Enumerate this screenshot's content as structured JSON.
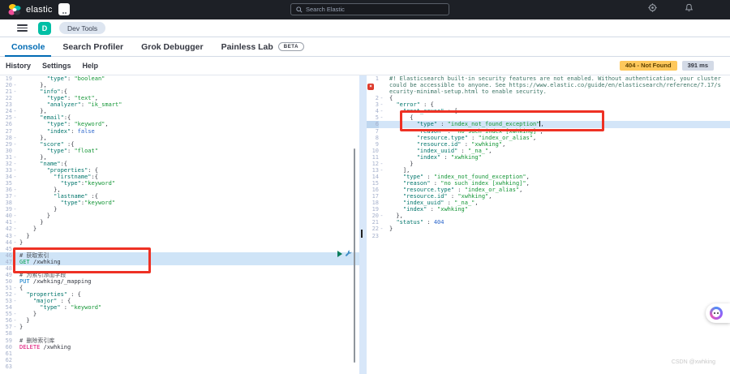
{
  "colors": {
    "header_bg": "#1d2026",
    "accent_blue": "#006bb4",
    "space_avatar_green": "#00bfa5",
    "status_badge_bg": "#fec85c",
    "duration_badge_bg": "#d3dae6",
    "selection_blue": "#cfe4f7",
    "annotation_red": "#ee3124",
    "key_teal": "#00756b",
    "string_green": "#149636",
    "method_get": "#0aa255",
    "method_put": "#0377c9",
    "method_delete": "#dd0a73"
  },
  "header": {
    "logo_text": "elastic",
    "search_placeholder": "Search Elastic"
  },
  "nav": {
    "space_initial": "D",
    "breadcrumb": "Dev Tools"
  },
  "tabs": [
    {
      "label": "Console"
    },
    {
      "label": "Search Profiler"
    },
    {
      "label": "Grok Debugger"
    },
    {
      "label": "Painless Lab",
      "badge": "BETA"
    }
  ],
  "toolbar": {
    "history": "History",
    "settings": "Settings",
    "help": "Help",
    "status_badge": "404 - Not Found",
    "duration_badge": "391 ms"
  },
  "watermark": "CSDN @xwhking",
  "request_editor": {
    "lines": [
      {
        "n": 19,
        "t": [
          [
            "        ",
            "p"
          ],
          [
            "\"type\"",
            "k"
          ],
          [
            ": ",
            "p"
          ],
          [
            "\"boolean\"",
            "s"
          ]
        ]
      },
      {
        "n": 20,
        "fold": true,
        "t": [
          [
            "      },",
            "p"
          ]
        ]
      },
      {
        "n": 21,
        "fold": true,
        "t": [
          [
            "      ",
            "p"
          ],
          [
            "\"info\"",
            "k"
          ],
          [
            ":{",
            "p"
          ]
        ]
      },
      {
        "n": 22,
        "t": [
          [
            "        ",
            "p"
          ],
          [
            "\"type\"",
            "k"
          ],
          [
            ": ",
            "p"
          ],
          [
            "\"text\"",
            "s"
          ],
          [
            ",",
            "p"
          ]
        ]
      },
      {
        "n": 23,
        "t": [
          [
            "        ",
            "p"
          ],
          [
            "\"analyzer\"",
            "k"
          ],
          [
            ": ",
            "p"
          ],
          [
            "\"ik_smart\"",
            "s"
          ]
        ]
      },
      {
        "n": 24,
        "fold": true,
        "t": [
          [
            "      },",
            "p"
          ]
        ]
      },
      {
        "n": 25,
        "fold": true,
        "t": [
          [
            "      ",
            "p"
          ],
          [
            "\"email\"",
            "k"
          ],
          [
            ":{",
            "p"
          ]
        ]
      },
      {
        "n": 26,
        "t": [
          [
            "        ",
            "p"
          ],
          [
            "\"type\"",
            "k"
          ],
          [
            ": ",
            "p"
          ],
          [
            "\"keyword\"",
            "s"
          ],
          [
            ",",
            "p"
          ]
        ]
      },
      {
        "n": 27,
        "t": [
          [
            "        ",
            "p"
          ],
          [
            "\"index\"",
            "k"
          ],
          [
            ": ",
            "p"
          ],
          [
            "false",
            "n"
          ]
        ]
      },
      {
        "n": 28,
        "fold": true,
        "t": [
          [
            "      },",
            "p"
          ]
        ]
      },
      {
        "n": 29,
        "fold": true,
        "t": [
          [
            "      ",
            "p"
          ],
          [
            "\"score\"",
            "k"
          ],
          [
            " :{",
            "p"
          ]
        ]
      },
      {
        "n": 30,
        "t": [
          [
            "        ",
            "p"
          ],
          [
            "\"type\"",
            "k"
          ],
          [
            ": ",
            "p"
          ],
          [
            "\"float\"",
            "s"
          ]
        ]
      },
      {
        "n": 31,
        "fold": true,
        "t": [
          [
            "      },",
            "p"
          ]
        ]
      },
      {
        "n": 32,
        "fold": true,
        "t": [
          [
            "      ",
            "p"
          ],
          [
            "\"name\"",
            "k"
          ],
          [
            ":{",
            "p"
          ]
        ]
      },
      {
        "n": 33,
        "fold": true,
        "t": [
          [
            "        ",
            "p"
          ],
          [
            "\"properties\"",
            "k"
          ],
          [
            ": {",
            "p"
          ]
        ]
      },
      {
        "n": 34,
        "fold": true,
        "t": [
          [
            "          ",
            "p"
          ],
          [
            "\"firstname\"",
            "k"
          ],
          [
            ":{",
            "p"
          ]
        ]
      },
      {
        "n": 35,
        "t": [
          [
            "            ",
            "p"
          ],
          [
            "\"type\"",
            "k"
          ],
          [
            ":",
            "p"
          ],
          [
            "\"keyword\"",
            "s"
          ]
        ]
      },
      {
        "n": 36,
        "fold": true,
        "t": [
          [
            "          },",
            "p"
          ]
        ]
      },
      {
        "n": 37,
        "fold": true,
        "t": [
          [
            "          ",
            "p"
          ],
          [
            "\"lastname\"",
            "k"
          ],
          [
            " :{",
            "p"
          ]
        ]
      },
      {
        "n": 38,
        "t": [
          [
            "            ",
            "p"
          ],
          [
            "\"type\"",
            "k"
          ],
          [
            ":",
            "p"
          ],
          [
            "\"keyword\"",
            "s"
          ]
        ]
      },
      {
        "n": 39,
        "fold": true,
        "t": [
          [
            "          }",
            "p"
          ]
        ]
      },
      {
        "n": 40,
        "fold": true,
        "t": [
          [
            "        }",
            "p"
          ]
        ]
      },
      {
        "n": 41,
        "fold": true,
        "t": [
          [
            "      }",
            "p"
          ]
        ]
      },
      {
        "n": 42,
        "fold": true,
        "t": [
          [
            "    }",
            "p"
          ]
        ]
      },
      {
        "n": 43,
        "fold": true,
        "t": [
          [
            "  }",
            "p"
          ]
        ]
      },
      {
        "n": 44,
        "fold": true,
        "t": [
          [
            "}",
            "p"
          ]
        ]
      },
      {
        "n": 45,
        "t": []
      },
      {
        "n": 46,
        "hl": true,
        "t": [
          [
            "# 获取索引",
            "c"
          ]
        ]
      },
      {
        "n": 47,
        "hl": true,
        "t": [
          [
            "GET",
            "get"
          ],
          [
            " /xwhking",
            "u"
          ]
        ]
      },
      {
        "n": 48,
        "t": []
      },
      {
        "n": 49,
        "t": [
          [
            "# 为索引添加字段",
            "c"
          ]
        ]
      },
      {
        "n": 50,
        "t": [
          [
            "PUT",
            "put"
          ],
          [
            " /xwhking/_mapping",
            "u"
          ]
        ]
      },
      {
        "n": 51,
        "fold": true,
        "t": [
          [
            "{",
            "p"
          ]
        ]
      },
      {
        "n": 52,
        "fold": true,
        "t": [
          [
            "  ",
            "p"
          ],
          [
            "\"properties\"",
            "k"
          ],
          [
            " : {",
            "p"
          ]
        ]
      },
      {
        "n": 53,
        "fold": true,
        "t": [
          [
            "    ",
            "p"
          ],
          [
            "\"major\"",
            "k"
          ],
          [
            " : {",
            "p"
          ]
        ]
      },
      {
        "n": 54,
        "t": [
          [
            "      ",
            "p"
          ],
          [
            "\"type\"",
            "k"
          ],
          [
            " : ",
            "p"
          ],
          [
            "\"keyword\"",
            "s"
          ]
        ]
      },
      {
        "n": 55,
        "fold": true,
        "t": [
          [
            "    }",
            "p"
          ]
        ]
      },
      {
        "n": 56,
        "fold": true,
        "t": [
          [
            "  }",
            "p"
          ]
        ]
      },
      {
        "n": 57,
        "fold": true,
        "t": [
          [
            "}",
            "p"
          ]
        ]
      },
      {
        "n": 58,
        "t": []
      },
      {
        "n": 59,
        "t": [
          [
            "# 删除索引库",
            "c"
          ]
        ]
      },
      {
        "n": 60,
        "t": [
          [
            "DELETE",
            "del"
          ],
          [
            " /xwhking",
            "u"
          ]
        ]
      },
      {
        "n": 61,
        "t": []
      },
      {
        "n": 62,
        "t": []
      },
      {
        "n": 63,
        "t": []
      }
    ]
  },
  "response_editor": {
    "lines": [
      {
        "n": 1,
        "wrap": true,
        "t": [
          [
            "#! Elasticsearch built-in security features are not enabled. Without authentication, your cluster could be accessible to anyone. See https://www.elastic.co/guide/en/elasticsearch/reference/7.17/security-minimal-setup.html to enable security.",
            "w"
          ]
        ]
      },
      {
        "n": 2,
        "fold": true,
        "t": [
          [
            "{",
            "p"
          ]
        ]
      },
      {
        "n": 3,
        "fold": true,
        "t": [
          [
            "  ",
            "p"
          ],
          [
            "\"error\"",
            "k"
          ],
          [
            " : {",
            "p"
          ]
        ]
      },
      {
        "n": 4,
        "fold": true,
        "t": [
          [
            "    ",
            "p"
          ],
          [
            "\"root_cause\"",
            "k"
          ],
          [
            " : [",
            "p"
          ]
        ]
      },
      {
        "n": 5,
        "fold": true,
        "t": [
          [
            "      {",
            "p"
          ]
        ]
      },
      {
        "n": 6,
        "sel": true,
        "t": [
          [
            "        ",
            "p"
          ],
          [
            "\"type\"",
            "k"
          ],
          [
            " : ",
            "p"
          ],
          [
            "\"index_not_found_exception\"",
            "s"
          ],
          [
            "",
            "cur"
          ],
          [
            ",",
            "p"
          ]
        ]
      },
      {
        "n": 7,
        "t": [
          [
            "        ",
            "p"
          ],
          [
            "\"reason\"",
            "k"
          ],
          [
            " : ",
            "p"
          ],
          [
            "\"no such index [xwhking]\"",
            "s"
          ],
          [
            ",",
            "p"
          ]
        ]
      },
      {
        "n": 8,
        "t": [
          [
            "        ",
            "p"
          ],
          [
            "\"resource.type\"",
            "k"
          ],
          [
            " : ",
            "p"
          ],
          [
            "\"index_or_alias\"",
            "s"
          ],
          [
            ",",
            "p"
          ]
        ]
      },
      {
        "n": 9,
        "t": [
          [
            "        ",
            "p"
          ],
          [
            "\"resource.id\"",
            "k"
          ],
          [
            " : ",
            "p"
          ],
          [
            "\"xwhking\"",
            "s"
          ],
          [
            ",",
            "p"
          ]
        ]
      },
      {
        "n": 10,
        "t": [
          [
            "        ",
            "p"
          ],
          [
            "\"index_uuid\"",
            "k"
          ],
          [
            " : ",
            "p"
          ],
          [
            "\"_na_\"",
            "s"
          ],
          [
            ",",
            "p"
          ]
        ]
      },
      {
        "n": 11,
        "t": [
          [
            "        ",
            "p"
          ],
          [
            "\"index\"",
            "k"
          ],
          [
            " : ",
            "p"
          ],
          [
            "\"xwhking\"",
            "s"
          ]
        ]
      },
      {
        "n": 12,
        "fold": true,
        "t": [
          [
            "      }",
            "p"
          ]
        ]
      },
      {
        "n": 13,
        "fold": true,
        "t": [
          [
            "    ],",
            "p"
          ]
        ]
      },
      {
        "n": 14,
        "t": [
          [
            "    ",
            "p"
          ],
          [
            "\"type\"",
            "k"
          ],
          [
            " : ",
            "p"
          ],
          [
            "\"index_not_found_exception\"",
            "s"
          ],
          [
            ",",
            "p"
          ]
        ]
      },
      {
        "n": 15,
        "t": [
          [
            "    ",
            "p"
          ],
          [
            "\"reason\"",
            "k"
          ],
          [
            " : ",
            "p"
          ],
          [
            "\"no such index [xwhking]\"",
            "s"
          ],
          [
            ",",
            "p"
          ]
        ]
      },
      {
        "n": 16,
        "t": [
          [
            "    ",
            "p"
          ],
          [
            "\"resource.type\"",
            "k"
          ],
          [
            " : ",
            "p"
          ],
          [
            "\"index_or_alias\"",
            "s"
          ],
          [
            ",",
            "p"
          ]
        ]
      },
      {
        "n": 17,
        "t": [
          [
            "    ",
            "p"
          ],
          [
            "\"resource.id\"",
            "k"
          ],
          [
            " : ",
            "p"
          ],
          [
            "\"xwhking\"",
            "s"
          ],
          [
            ",",
            "p"
          ]
        ]
      },
      {
        "n": 18,
        "t": [
          [
            "    ",
            "p"
          ],
          [
            "\"index_uuid\"",
            "k"
          ],
          [
            " : ",
            "p"
          ],
          [
            "\"_na_\"",
            "s"
          ],
          [
            ",",
            "p"
          ]
        ]
      },
      {
        "n": 19,
        "t": [
          [
            "    ",
            "p"
          ],
          [
            "\"index\"",
            "k"
          ],
          [
            " : ",
            "p"
          ],
          [
            "\"xwhking\"",
            "s"
          ]
        ]
      },
      {
        "n": 20,
        "fold": true,
        "t": [
          [
            "  },",
            "p"
          ]
        ]
      },
      {
        "n": 21,
        "t": [
          [
            "  ",
            "p"
          ],
          [
            "\"status\"",
            "k"
          ],
          [
            " : ",
            "p"
          ],
          [
            "404",
            "n"
          ]
        ]
      },
      {
        "n": 22,
        "fold": true,
        "t": [
          [
            "}",
            "p"
          ]
        ]
      },
      {
        "n": 23,
        "t": []
      }
    ]
  }
}
